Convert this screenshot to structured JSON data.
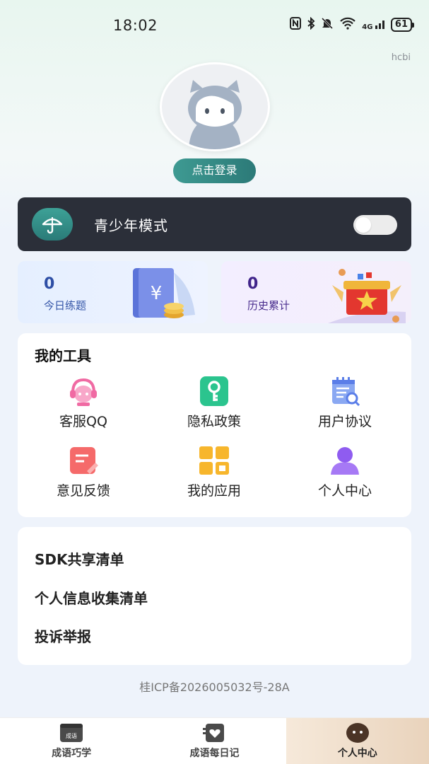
{
  "status_bar": {
    "time": "18:02",
    "network": "4G",
    "battery": "61"
  },
  "corner_label": "hcbi",
  "profile": {
    "login_label": "点击登录"
  },
  "teen_mode": {
    "label": "青少年模式",
    "enabled": false
  },
  "stats": [
    {
      "value": "0",
      "label": "今日练题"
    },
    {
      "value": "0",
      "label": "历史累计"
    }
  ],
  "tools": {
    "title": "我的工具",
    "items": [
      {
        "label": "客服QQ",
        "icon": "customer-service-icon"
      },
      {
        "label": "隐私政策",
        "icon": "key-icon"
      },
      {
        "label": "用户协议",
        "icon": "document-search-icon"
      },
      {
        "label": "意见反馈",
        "icon": "feedback-note-icon"
      },
      {
        "label": "我的应用",
        "icon": "app-grid-icon"
      },
      {
        "label": "个人中心",
        "icon": "user-icon"
      }
    ]
  },
  "links": [
    {
      "label": "SDK共享清单"
    },
    {
      "label": "个人信息收集清单"
    },
    {
      "label": "投诉举报"
    }
  ],
  "icp": "桂ICP备2026005032号-28A",
  "bottom_nav": [
    {
      "label": "成语巧学",
      "icon": "book-icon",
      "active": false
    },
    {
      "label": "成语每日记",
      "icon": "heart-card-icon",
      "active": false
    },
    {
      "label": "个人中心",
      "icon": "face-icon",
      "active": true
    }
  ],
  "colors": {
    "accent": "#2c7a78",
    "teen_bar": "#2b2f39",
    "active_tab": "#e9d3bc"
  }
}
